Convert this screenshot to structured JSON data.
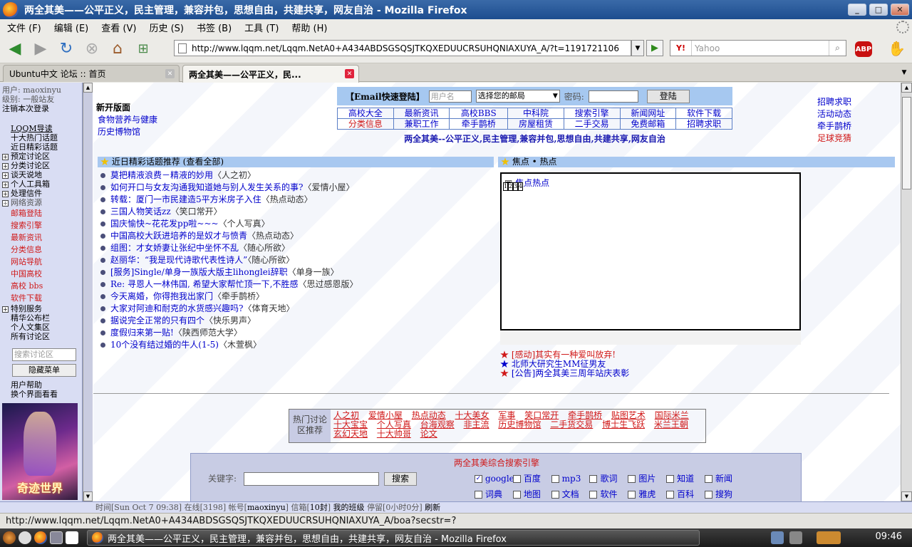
{
  "window": {
    "title": "两全其美——公平正义，民主管理，兼容并包，思想自由，共建共享，网友自治 - Mozilla Firefox",
    "min": "_",
    "max": "□",
    "close": "✕"
  },
  "menu": [
    "文件 (F)",
    "编辑 (E)",
    "查看 (V)",
    "历史 (S)",
    "书签 (B)",
    "工具 (T)",
    "帮助 (H)"
  ],
  "nav": {
    "url": "http://www.lqqm.net/Lqqm.NetA0+A434ABDSGSQSJTKQXEDUUCRSUHQNIAXUYA_A/?t=1191721106",
    "search_engine": "Y!",
    "search_placeholder": "Yahoo",
    "abp": "ABP"
  },
  "tabs": [
    {
      "label": "Ubuntu中文 论坛 :: 首页"
    },
    {
      "label": "两全其美——公平正义，民..."
    }
  ],
  "sidebar": {
    "user": "用户: maoxinyu",
    "level": "级别: 一般站友",
    "logout": "注销本次登录",
    "guide": "LQQM导读",
    "top10": "十大热门话题",
    "recent": "近日精彩话题",
    "groups": [
      "预定讨论区",
      "分类讨论区",
      "谈天说地",
      "个人工具箱",
      "处理信件",
      "网络资源"
    ],
    "red_links": [
      "邮箱登陆",
      "搜索引擎",
      "最新资讯",
      "分类信息",
      "网站导航",
      "中国高校",
      "高校 bbs",
      "软件下载"
    ],
    "special": "特别服务",
    "extras": [
      "精华公布栏",
      "个人文集区",
      "所有讨论区"
    ],
    "search_placeholder": "搜索讨论区",
    "hide_menu": "隐藏菜单",
    "help": "用户帮助",
    "skin": "换个界面看看",
    "avatar_text": "奇迹世界"
  },
  "main": {
    "new_section": "新开版面",
    "new_links": [
      "食物营养与健康",
      "历史博物馆"
    ],
    "login": {
      "label": "【Email快速登陆】",
      "user_placeholder": "用户名",
      "select": "选择您的邮局",
      "pwd_label": "密码:",
      "button": "登陆"
    },
    "grid": [
      [
        "高校大全",
        "最新资讯",
        "高校BBS",
        "中科院",
        "搜索引擎",
        "新闻网址",
        "软件下载"
      ],
      [
        "分类信息",
        "兼职工作",
        "牵手鹊桥",
        "房屋租赁",
        "二手交易",
        "免费邮箱",
        "招聘求职"
      ]
    ],
    "slogan": "两全其美--公平正义,民主管理,兼容并包,思想自由,共建共享,网友自治",
    "right_links": [
      "招聘求职",
      "活动动态",
      "牵手鹊桥",
      "足球竞猜"
    ],
    "recent_header": "近日精彩话题推荐  (查看全部)",
    "focus_header": "焦点 • 热点",
    "topics": [
      {
        "title": "莫把精液浪费－精液的妙用",
        "board": "〈人之初〉"
      },
      {
        "title": "如何开口与女友沟通我知道她与别人发生关系的事?",
        "board": "〈爱情小屋〉"
      },
      {
        "title": "转载：厦门一市民建造5平方米房子入住",
        "board": "〈热点动态〉"
      },
      {
        "title": "三国人物笑话zz",
        "board": "〈笑口常开〉"
      },
      {
        "title": "国庆愉快~花花发pp啦~~~",
        "board": "〈个人写真〉"
      },
      {
        "title": "中国高校大跃进培养的是奴才与愤青",
        "board": "〈热点动态〉"
      },
      {
        "title": "组图：才女娇妻让张纪中坐怀不乱",
        "board": "〈随心所欲〉"
      },
      {
        "title": "赵丽华：“我是现代诗歌代表性诗人”",
        "board": "〈随心所欲〉"
      },
      {
        "title": "[服务]Single/单身一族版大版主lihonglei辞职",
        "board": "〈单身一族〉"
      },
      {
        "title": "Re: 寻恩人一林伟国, 希望大家帮忙顶一下,不胜感",
        "board": "〈思过感恩版〉"
      },
      {
        "title": "今天离婚，你得抱我出家门",
        "board": "〈牵手鹊桥〉"
      },
      {
        "title": "大家对阿迪和耐克的水货感兴趣吗?",
        "board": "〈体育天地〉"
      },
      {
        "title": "据说完全正常的只有四个",
        "board": "〈快乐男声〉"
      },
      {
        "title": "度假归来第一贴!",
        "board": "〈陕西师范大学〉"
      },
      {
        "title": "10个没有结过婚的牛人(1-5)",
        "board": "〈木萱枫〉"
      }
    ],
    "focus_placeholder": "焦点热点",
    "focus_nums": [
      "1",
      "2",
      "3",
      "4"
    ],
    "news": [
      {
        "text": "[感动]其实有一种爱叫放弃!",
        "color": "#d01818",
        "star": "#d01818"
      },
      {
        "text": "北师大研究生MM征男友",
        "color": "#0000cc",
        "star": "#0000cc"
      },
      {
        "text": "[公告]两全其美三周年站庆表彰",
        "color": "#0000cc",
        "star": "#d01818"
      }
    ],
    "hot_label": "热门讨论区推荐",
    "hot_links": [
      "人之初",
      "爱情小屋",
      "热点动态",
      "十大美女",
      "军事",
      "笑口常开",
      "牵手鹊桥",
      "贴图艺术",
      "国际米兰",
      "十大宝宝",
      "个人写真",
      "台海观察",
      "非主流",
      "历史博物馆",
      "二手货交易",
      "博士生飞跃",
      "米兰王朝",
      "玄幻天地",
      "十大帅哥",
      "论文"
    ],
    "search": {
      "title": "两全其美综合搜索引擎",
      "kw_label": "关键字:",
      "button": "搜索",
      "options": [
        "google",
        "百度",
        "mp3",
        "歌词",
        "图片",
        "知道",
        "新闻",
        "词典",
        "地图",
        "文档",
        "软件",
        "雅虎",
        "百科",
        "搜狗"
      ],
      "checked": "google"
    }
  },
  "status_row": {
    "time": "时间[Sun Oct  7 09:38]",
    "online": "在线[3198]",
    "account_label": "帐号[",
    "account": "maoxinyu",
    "account_end": "]",
    "mail_label": "信箱[",
    "mail": "10封",
    "mail_end": "]",
    "myclass": "我的班级",
    "stay": "停留[0小时0分]",
    "refresh": "刷新"
  },
  "ff_status": "http://www.lqqm.net/Lqqm.NetA0+A434ABDSGSQSJTKQXEDUUCRSUHQNIAXUYA_A/boa?secstr=?",
  "taskbar": {
    "task": "两全其美——公平正义，民主管理，兼容并包，思想自由，共建共享，网友自治 - Mozilla Firefox",
    "clock": "09:46"
  }
}
